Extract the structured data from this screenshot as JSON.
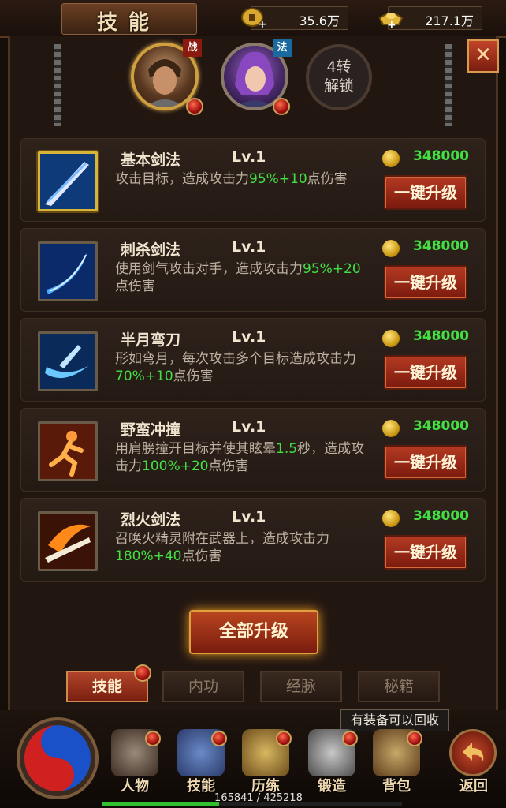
{
  "header": {
    "title": "技能",
    "gold": "35.6万",
    "ingot": "217.1万"
  },
  "portraits": [
    {
      "class_tag": "战"
    },
    {
      "class_tag": "法"
    }
  ],
  "unlock": {
    "line1": "4转",
    "line2": "解锁"
  },
  "skills": [
    {
      "name": "基本剑法",
      "level": "Lv.1",
      "cost": "348000",
      "desc_a": "攻击目标，造成攻击力",
      "desc_b": "95%+10",
      "desc_c": "点伤害",
      "button": "一键升级"
    },
    {
      "name": "刺杀剑法",
      "level": "Lv.1",
      "cost": "348000",
      "desc_a": "使用剑气攻击对手，造成攻击力",
      "desc_b": "95%+20",
      "desc_c": "点伤害",
      "button": "一键升级"
    },
    {
      "name": "半月弯刀",
      "level": "Lv.1",
      "cost": "348000",
      "desc_a": "形如弯月，每次攻击多个目标造成攻击力",
      "desc_b": "70%+10",
      "desc_c": "点伤害",
      "button": "一键升级"
    },
    {
      "name": "野蛮冲撞",
      "level": "Lv.1",
      "cost": "348000",
      "desc_a": "用肩膀撞开目标并使其眩晕",
      "desc_b": "1.5",
      "desc_c": "秒，造成攻击力",
      "desc_d": "100%+20",
      "desc_e": "点伤害",
      "button": "一键升级"
    },
    {
      "name": "烈火剑法",
      "level": "Lv.1",
      "cost": "348000",
      "desc_a": "召唤火精灵附在武器上，造成攻击力",
      "desc_b": "180%+40",
      "desc_c": "点伤害",
      "button": "一键升级"
    }
  ],
  "all_upgrade": "全部升级",
  "tabs": [
    "技能",
    "内功",
    "经脉",
    "秘籍"
  ],
  "tooltip": "有装备可以回收",
  "nav": [
    "人物",
    "技能",
    "历练",
    "锻造",
    "背包",
    "返回"
  ],
  "exp": {
    "text": "165841 / 425218",
    "fraction": 0.39
  }
}
